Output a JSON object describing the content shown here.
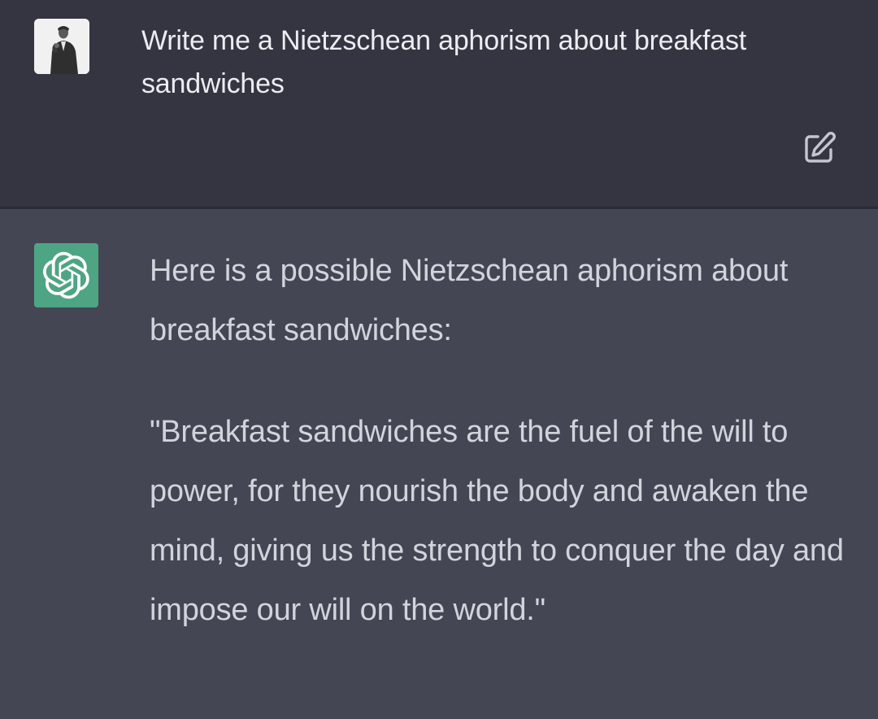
{
  "conversation": {
    "user_message": {
      "text": "Write me a Nietzschean aphorism about breakfast sandwiches"
    },
    "assistant_message": {
      "paragraphs": [
        "Here is a possible Nietzschean aphorism about breakfast sandwiches:",
        "\"Breakfast sandwiches are the fuel of the will to power, for they nourish the body and awaken the mind, giving us the strength to conquer the day and impose our will on the world.\""
      ]
    }
  },
  "icons": {
    "user_avatar": "user-photo-avatar",
    "assistant_avatar": "openai-logo-icon",
    "edit": "edit-icon"
  },
  "colors": {
    "user_bg": "#343541",
    "assistant_bg": "#444654",
    "avatar_green": "#4ea584",
    "text": "#ececf1"
  }
}
